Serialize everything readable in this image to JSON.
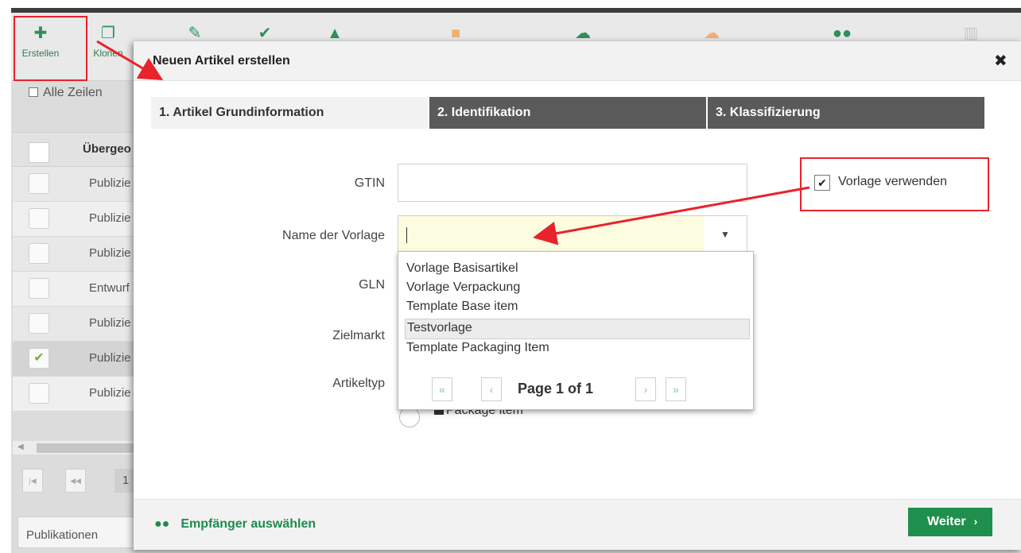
{
  "toolbar": {
    "create_label": "Erstellen",
    "clone_label": "Klonen",
    "icons": {
      "create": "plus-icon",
      "clone": "clone-icon",
      "edit": "pencil-icon",
      "approve": "check-icon",
      "thumb": "thumbs-up-icon",
      "flag": "flag-icon",
      "upload": "cloud-upload-icon",
      "download": "cloud-download-icon",
      "users": "users-icon",
      "delete": "trash-icon"
    }
  },
  "list": {
    "select_all": "Alle Zeilen",
    "header": "Übergeo",
    "rows": [
      {
        "status": "Publizie",
        "checked": false
      },
      {
        "status": "Publizie",
        "checked": false
      },
      {
        "status": "Publizie",
        "checked": false
      },
      {
        "status": "Entwurf",
        "checked": false
      },
      {
        "status": "Publizie",
        "checked": false
      },
      {
        "status": "Publizie",
        "checked": true
      },
      {
        "status": "Publizie",
        "checked": false
      }
    ],
    "pager_page": "1",
    "bottom_tab": "Publikationen"
  },
  "modal": {
    "title": "Neuen Artikel erstellen",
    "close_symbol": "✖",
    "steps": [
      {
        "label": "1. Artikel Grundinformation",
        "active": true
      },
      {
        "label": "2. Identifikation",
        "active": false
      },
      {
        "label": "3. Klassifizierung",
        "active": false
      }
    ],
    "fields": {
      "gtin_label": "GTIN",
      "gtin_value": "",
      "template_name_label": "Name der Vorlage",
      "template_name_value": "",
      "gln_label": "GLN",
      "target_market_label": "Zielmarkt",
      "article_type_label": "Artikeltyp",
      "package_item_label": "Package item"
    },
    "use_template": {
      "label": "Vorlage verwenden",
      "checked": true
    },
    "template_options": [
      "Vorlage Basisartikel",
      "Vorlage Verpackung",
      "Template Base item",
      "Testvorlage",
      "Template Packaging Item"
    ],
    "highlighted_option": "Testvorlage",
    "dropdown_pager": {
      "first": "«",
      "prev": "‹",
      "text": "Page 1 of 1",
      "next": "›",
      "last": "»"
    },
    "footer": {
      "recipients_link": "Empfänger auswählen",
      "next_button": "Weiter",
      "next_chevron": "›"
    }
  },
  "colors": {
    "accent_green": "#1f8f4d",
    "annotation_red": "#e8232b",
    "step_inactive": "#5a5a5a",
    "template_input_bg": "#fcfce0"
  }
}
